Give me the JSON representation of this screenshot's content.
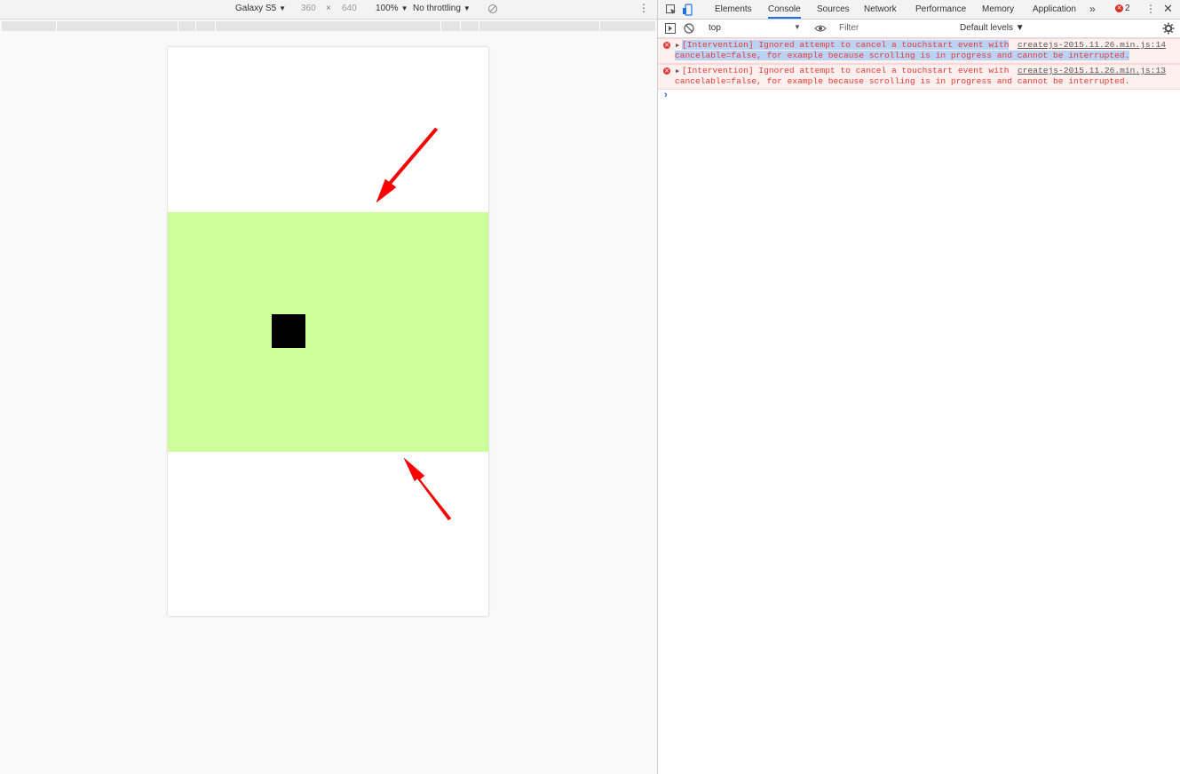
{
  "device_toolbar": {
    "device": "Galaxy S5",
    "width": "360",
    "times": "×",
    "height": "640",
    "zoom": "100%",
    "throttle": "No throttling",
    "more_glyph": "⋮",
    "caret": "▼"
  },
  "devtools": {
    "tabs": [
      "Elements",
      "Console",
      "Sources",
      "Network",
      "Performance",
      "Memory",
      "Application"
    ],
    "active_tab": "Console",
    "overflow_glyph": "»",
    "error_count": "2",
    "kebab_glyph": "⋮",
    "close_glyph": "✕"
  },
  "console_toolbar": {
    "context": "top",
    "filter_placeholder": "Filter",
    "levels": "Default levels ▼",
    "caret": "▼"
  },
  "messages": [
    {
      "line1": "[Intervention] Ignored attempt to cancel a touchstart event with",
      "line2": "cancelable=false, for example because scrolling is in progress and cannot be interrupted.",
      "source": "createjs-2015.11.26.min.js:14",
      "selected": true
    },
    {
      "line1": "[Intervention] Ignored attempt to cancel a touchstart event with",
      "line2": "cancelable=false, for example because scrolling is in progress and cannot be interrupted.",
      "source": "createjs-2015.11.26.min.js:13",
      "selected": false
    }
  ],
  "prompt_glyph": "›",
  "colors": {
    "stage": "#ccff99",
    "sprite": "#000000",
    "annotation_arrow": "#ff0000",
    "error_text": "#e53935",
    "active_tab_underline": "#1a73e8"
  }
}
